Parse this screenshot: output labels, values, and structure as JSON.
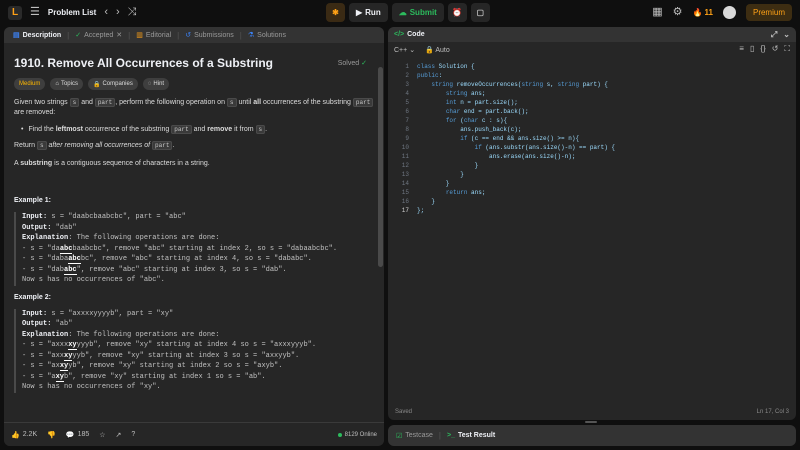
{
  "topbar": {
    "problem_list": "Problem List",
    "run": "Run",
    "submit": "Submit",
    "streak": "11",
    "premium": "Premium"
  },
  "left_tabs": [
    {
      "label": "Description",
      "icon": "document-icon"
    },
    {
      "label": "Accepted",
      "icon": "check-icon"
    },
    {
      "label": "Editorial",
      "icon": "book-icon"
    },
    {
      "label": "Submissions",
      "icon": "history-icon"
    },
    {
      "label": "Solutions",
      "icon": "flask-icon"
    }
  ],
  "problem": {
    "title": "1910. Remove All Occurrences of a Substring",
    "solved": "Solved",
    "difficulty": "Medium",
    "topics": "Topics",
    "companies": "Companies",
    "hint": "Hint",
    "para1_a": "Given two strings ",
    "s": "s",
    "and": " and ",
    "part": "part",
    "para1_b": ", perform the following operation on ",
    "para1_c": " until ",
    "all": "all",
    "para1_d": " occurrences of the substring ",
    "para1_e": " are removed:",
    "bullet_a": "Find the ",
    "leftmost": "leftmost",
    "bullet_b": " occurrence of the substring ",
    "bullet_c": " and ",
    "remove": "remove",
    "bullet_d": " it from ",
    "bullet_e": ".",
    "return_a": "Return ",
    "return_b": " after removing all occurrences of ",
    "return_c": ".",
    "def_a": "A ",
    "substring": "substring",
    "def_b": " is a contiguous sequence of characters in a string."
  },
  "examples": [
    {
      "heading": "Example 1:",
      "input_label": "Input:",
      "input": " s = \"daabcbaabcbc\", part = \"abc\"",
      "output_label": "Output:",
      "output": " \"dab\"",
      "explanation_label": "Explanation",
      "explanation": ": The following operations are done:",
      "steps": [
        {
          "pre": "- s = \"da",
          "hl": "abc",
          "post": "baabcbc\", remove \"abc\" starting at index 2, so s = \"dabaabcbc\"."
        },
        {
          "pre": "- s = \"daba",
          "hl": "abc",
          "post": "bc\", remove \"abc\" starting at index 4, so s = \"dababc\"."
        },
        {
          "pre": "- s = \"dab",
          "hl": "abc",
          "post": "\", remove \"abc\" starting at index 3, so s = \"dab\"."
        }
      ],
      "tail": "Now s has no occurrences of \"abc\"."
    },
    {
      "heading": "Example 2:",
      "input_label": "Input:",
      "input": " s = \"axxxxyyyyb\", part = \"xy\"",
      "output_label": "Output:",
      "output": " \"ab\"",
      "explanation_label": "Explanation",
      "explanation": ": The following operations are done:",
      "steps": [
        {
          "pre": "- s = \"axxx",
          "hl": "xy",
          "post": "yyyb\", remove \"xy\" starting at index 4 so s = \"axxxyyyb\"."
        },
        {
          "pre": "- s = \"axx",
          "hl": "xy",
          "post": "yyb\", remove \"xy\" starting at index 3 so s = \"axxyyb\"."
        },
        {
          "pre": "- s = \"ax",
          "hl": "xy",
          "post": "yb\", remove \"xy\" starting at index 2 so s = \"axyb\"."
        },
        {
          "pre": "- s = \"a",
          "hl": "xy",
          "post": "b\", remove \"xy\" starting at index 1 so s = \"ab\"."
        }
      ],
      "tail": "Now s has no occurrences of \"xy\"."
    }
  ],
  "footer": {
    "likes": "2.2K",
    "comments": "185",
    "online": "8129 Online"
  },
  "code_panel": {
    "tab": "Code",
    "language": "C++",
    "mode": "Auto",
    "status": "Saved",
    "cursor": "Ln 17, Col 3",
    "lines": [
      "class Solution {",
      "public:",
      "    string removeOccurrences(string s, string part) {",
      "        string ans;",
      "        int n = part.size();",
      "        char end = part.back();",
      "        for (char c : s){",
      "            ans.push_back(c);",
      "            if (c == end && ans.size() >= n){",
      "                if (ans.substr(ans.size()-n) == part) {",
      "                    ans.erase(ans.size()-n);",
      "                }",
      "            }",
      "        }",
      "        return ans;",
      "    }",
      "};"
    ]
  },
  "bottom_tabs": {
    "testcase": "Testcase",
    "test_result": "Test Result"
  },
  "colors": {
    "accent_orange": "#ffa116",
    "accent_green": "#2cbb5d",
    "panel_bg": "#262626",
    "page_bg": "#0f0f0f"
  }
}
